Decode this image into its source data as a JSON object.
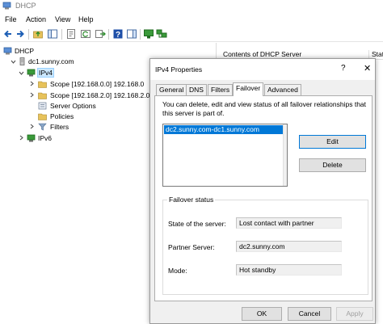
{
  "window": {
    "title": "DHCP"
  },
  "menu": [
    "File",
    "Action",
    "View",
    "Help"
  ],
  "toolbar": {
    "icons": [
      "back-icon",
      "forward-icon",
      "up-folder-icon",
      "show-hide-tree-icon",
      "properties-icon",
      "refresh-icon",
      "export-list-icon",
      "help-icon",
      "show-hide-action-pane-icon",
      "monitor-icon",
      "network-icon"
    ]
  },
  "tree": {
    "root": "DHCP",
    "server": "dc1.sunny.com",
    "ipv4": "IPv4",
    "scope1": "Scope [192.168.0.0] 192.168.0",
    "scope2": "Scope [192.168.2.0] 192.168.2.0",
    "server_options": "Server Options",
    "policies": "Policies",
    "filters": "Filters",
    "ipv6": "IPv6"
  },
  "content_header": {
    "col1": "Contents of DHCP Server",
    "col2": "Statu"
  },
  "dialog": {
    "title": "IPv4 Properties",
    "help": "?",
    "close": "✕",
    "tabs": [
      "General",
      "DNS",
      "Filters",
      "Failover",
      "Advanced"
    ],
    "active_tab": "Failover",
    "description": "You can delete, edit and view status of all failover relationships that this server is part of.",
    "relationships": [
      "dc2.sunny.com-dc1.sunny.com"
    ],
    "edit_label": "Edit",
    "delete_label": "Delete",
    "status_group": {
      "title": "Failover status",
      "state_label": "State of the server:",
      "state_value": "Lost contact with partner",
      "partner_label": "Partner Server:",
      "partner_value": "dc2.sunny.com",
      "mode_label": "Mode:",
      "mode_value": "Hot standby"
    },
    "ok_label": "OK",
    "cancel_label": "Cancel",
    "apply_label": "Apply"
  }
}
